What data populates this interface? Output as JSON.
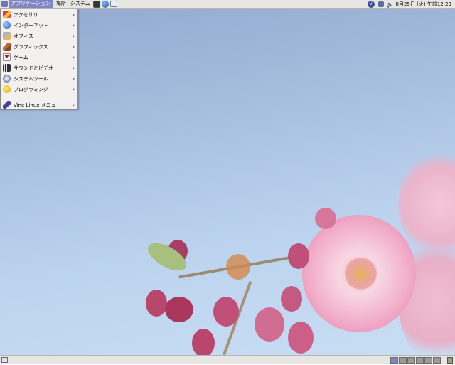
{
  "top_panel": {
    "menus": [
      {
        "label": "アプリケーション",
        "active": true
      },
      {
        "label": "場所",
        "active": false
      },
      {
        "label": "システム",
        "active": false
      }
    ],
    "launchers": [
      "terminal-icon",
      "web-browser-icon",
      "mail-icon"
    ],
    "tray_icons": [
      "vine-update-icon",
      "network-icon",
      "volume-icon"
    ],
    "clock": "8月25日 (火) 午前12:23"
  },
  "app_menu": {
    "items": [
      {
        "label": "アクセサリ",
        "icon": "accessories-icon",
        "submenu": true
      },
      {
        "label": "インターネット",
        "icon": "internet-icon",
        "submenu": true
      },
      {
        "label": "オフィス",
        "icon": "office-icon",
        "submenu": true
      },
      {
        "label": "グラフィックス",
        "icon": "graphics-icon",
        "submenu": true
      },
      {
        "label": "ゲーム",
        "icon": "games-icon",
        "submenu": true
      },
      {
        "label": "サウンドとビデオ",
        "icon": "sound-video-icon",
        "submenu": true
      },
      {
        "label": "システムツール",
        "icon": "system-tools-icon",
        "submenu": true
      },
      {
        "label": "プログラミング",
        "icon": "programming-icon",
        "submenu": true
      }
    ],
    "footer_item": {
      "label": "Vine Linux メニュー",
      "icon": "vine-menu-icon",
      "submenu": true
    },
    "arrow": "›"
  },
  "bottom_panel": {
    "workspaces": 6,
    "active_workspace": 1
  },
  "colors": {
    "panel": "#e8e6e2",
    "menu_highlight": "#7f86c4",
    "sky": "#b5cbea",
    "blossom": "#f2a9c8"
  }
}
